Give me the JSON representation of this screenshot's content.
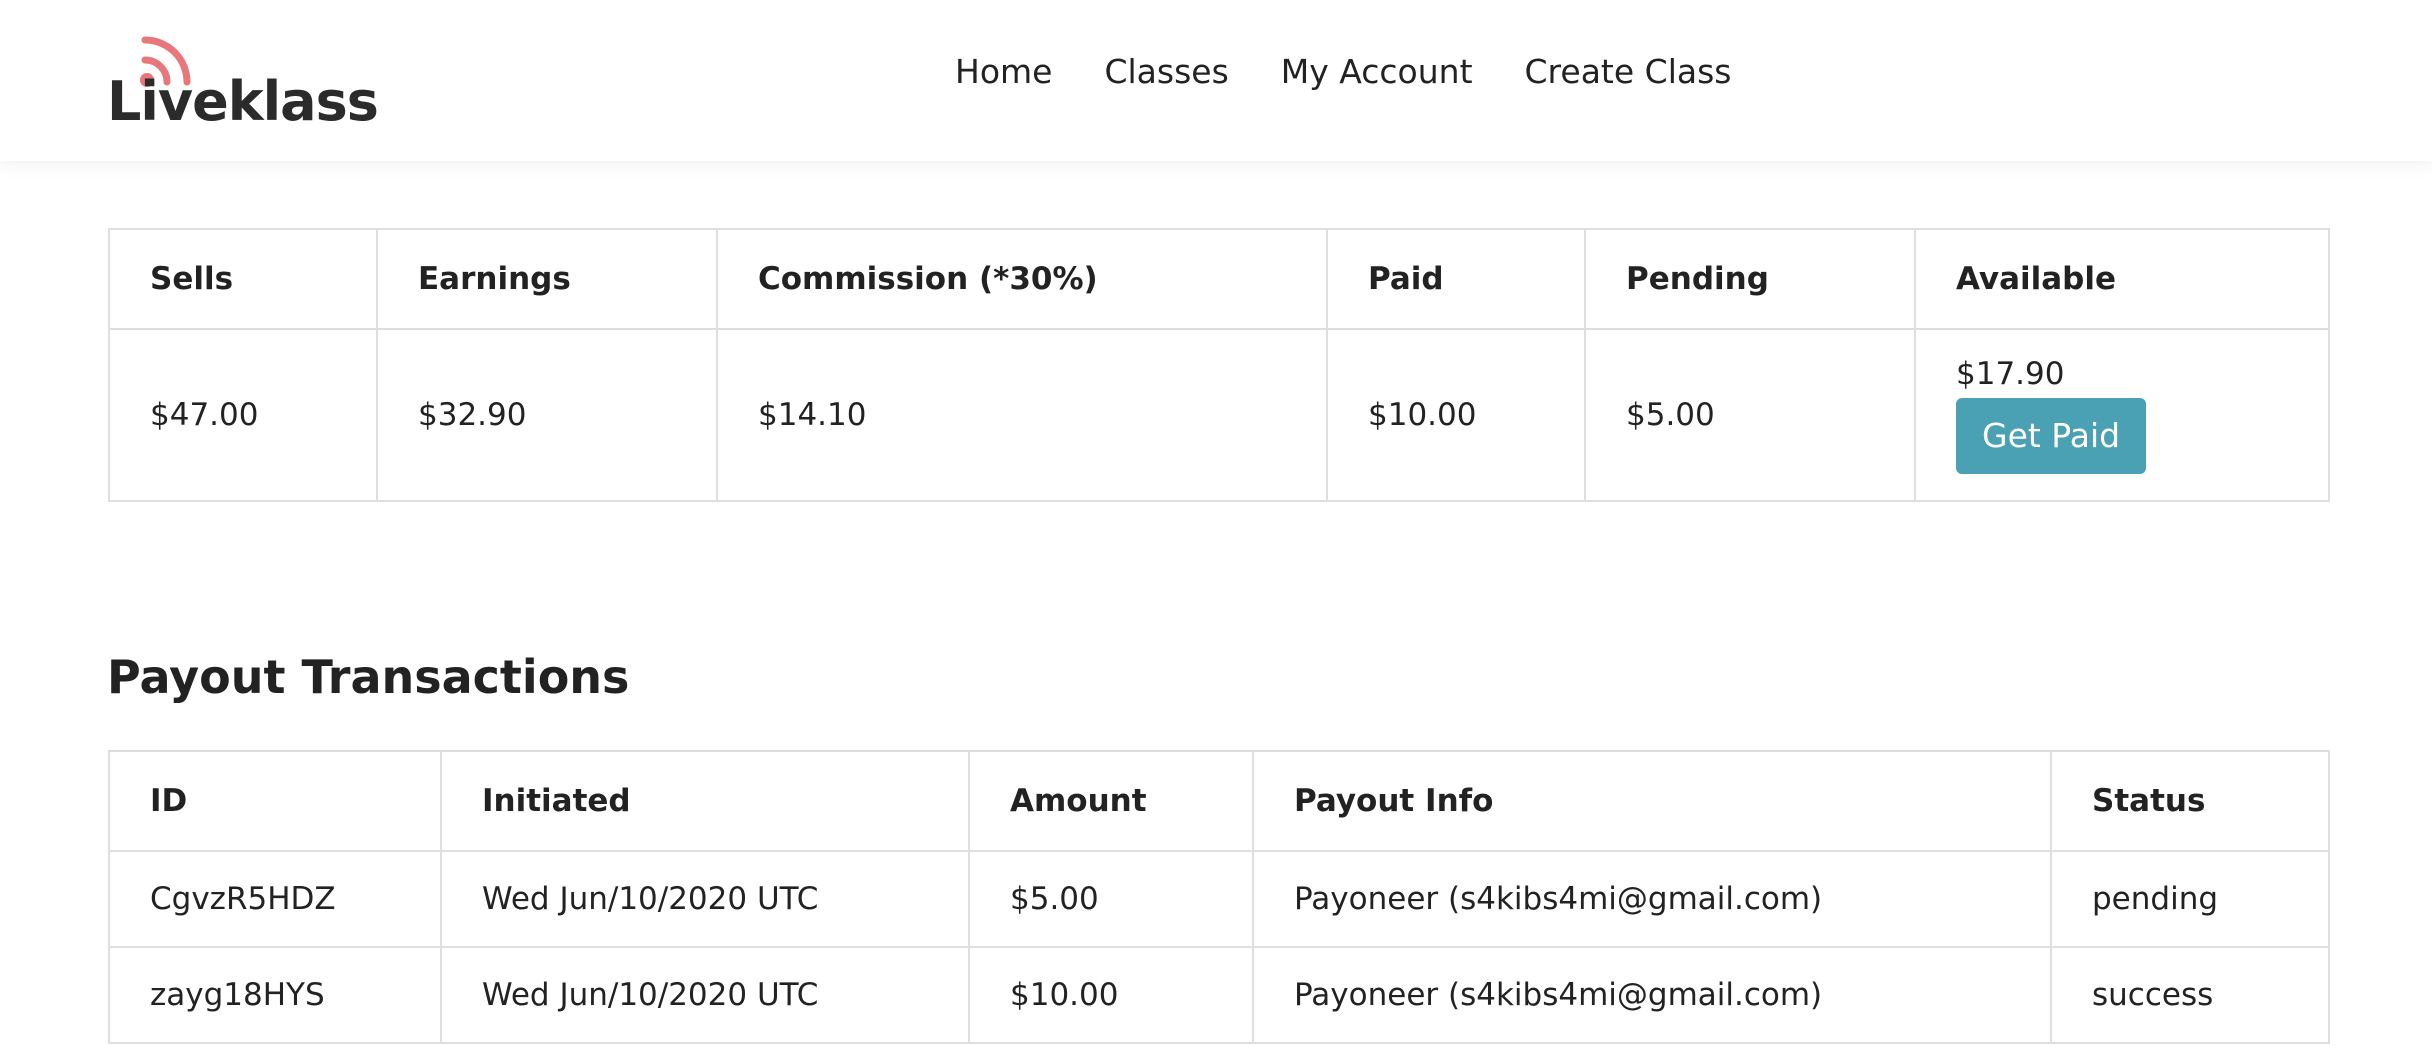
{
  "brand": {
    "name": "Liveklass",
    "accent_color": "#e8767a"
  },
  "nav": {
    "items": [
      {
        "label": "Home"
      },
      {
        "label": "Classes"
      },
      {
        "label": "My Account"
      },
      {
        "label": "Create Class"
      }
    ]
  },
  "summary": {
    "headers": [
      "Sells",
      "Earnings",
      "Commission (*30%)",
      "Paid",
      "Pending",
      "Available"
    ],
    "values": {
      "sells": "$47.00",
      "earnings": "$32.90",
      "commission": "$14.10",
      "paid": "$10.00",
      "pending": "$5.00",
      "available": "$17.90"
    },
    "get_paid_label": "Get Paid",
    "button_color": "#4aa1b4"
  },
  "payouts": {
    "title": "Payout Transactions",
    "headers": [
      "ID",
      "Initiated",
      "Amount",
      "Payout Info",
      "Status"
    ],
    "rows": [
      {
        "id": "CgvzR5HDZ",
        "initiated": "Wed Jun/10/2020 UTC",
        "amount": "$5.00",
        "info": "Payoneer (s4kibs4mi@gmail.com)",
        "status": "pending"
      },
      {
        "id": "zayg18HYS",
        "initiated": "Wed Jun/10/2020 UTC",
        "amount": "$10.00",
        "info": "Payoneer (s4kibs4mi@gmail.com)",
        "status": "success"
      }
    ]
  }
}
